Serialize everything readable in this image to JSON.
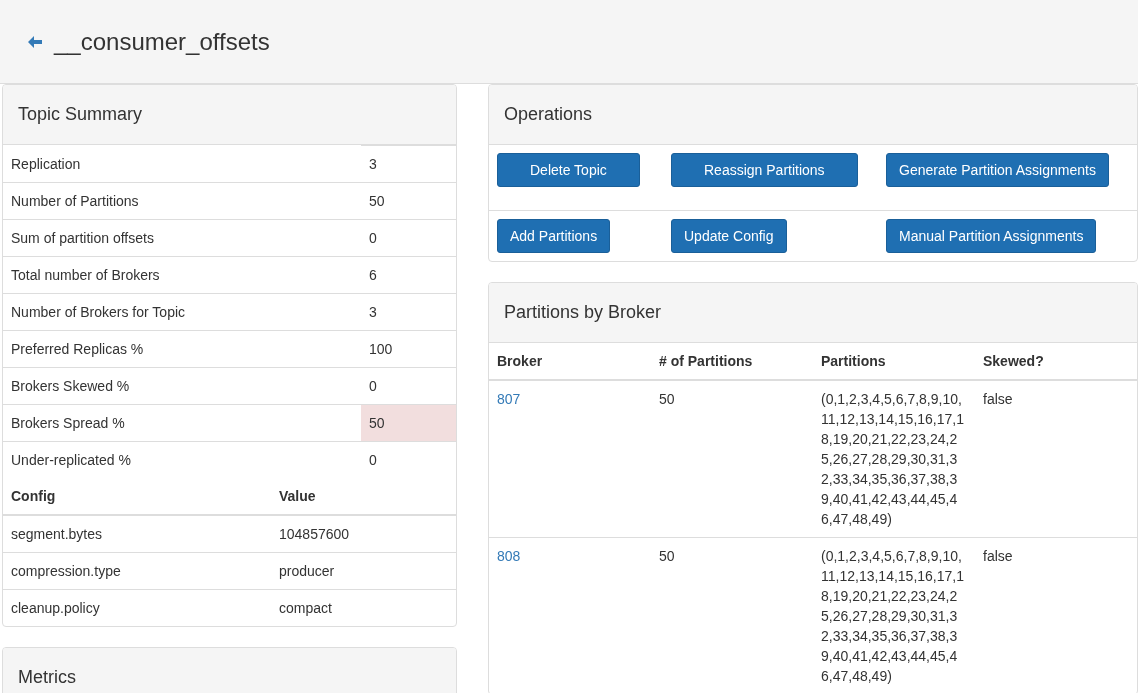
{
  "page": {
    "title": "__consumer_offsets"
  },
  "topic_summary": {
    "title": "Topic Summary",
    "rows": [
      {
        "label": "Replication",
        "value": "3",
        "warning": false
      },
      {
        "label": "Number of Partitions",
        "value": "50",
        "warning": false
      },
      {
        "label": "Sum of partition offsets",
        "value": "0",
        "warning": false
      },
      {
        "label": "Total number of Brokers",
        "value": "6",
        "warning": false
      },
      {
        "label": "Number of Brokers for Topic",
        "value": "3",
        "warning": false
      },
      {
        "label": "Preferred Replicas %",
        "value": "100",
        "warning": false
      },
      {
        "label": "Brokers Skewed %",
        "value": "0",
        "warning": false
      },
      {
        "label": "Brokers Spread %",
        "value": "50",
        "warning": true
      },
      {
        "label": "Under-replicated %",
        "value": "0",
        "warning": false
      }
    ],
    "config_columns": [
      "Config",
      "Value"
    ],
    "config_rows": [
      [
        "segment.bytes",
        "104857600"
      ],
      [
        "compression.type",
        "producer"
      ],
      [
        "cleanup.policy",
        "compact"
      ]
    ]
  },
  "metrics": {
    "title": "Metrics"
  },
  "operations": {
    "title": "Operations",
    "rows": [
      [
        "Delete Topic",
        "Reassign Partitions",
        "Generate Partition Assignments"
      ],
      [
        "Add Partitions",
        "Update Config",
        "Manual Partition Assignments"
      ]
    ]
  },
  "partitions_by_broker": {
    "title": "Partitions by Broker",
    "columns": [
      "Broker",
      "# of Partitions",
      "Partitions",
      "Skewed?"
    ],
    "rows": [
      {
        "broker": "807",
        "count": "50",
        "partitions": "(0,1,2,3,4,5,6,7,8,9,10,11,12,13,14,15,16,17,18,19,20,21,22,23,24,25,26,27,28,29,30,31,32,33,34,35,36,37,38,39,40,41,42,43,44,45,46,47,48,49)",
        "skewed": "false"
      },
      {
        "broker": "808",
        "count": "50",
        "partitions": "(0,1,2,3,4,5,6,7,8,9,10,11,12,13,14,15,16,17,18,19,20,21,22,23,24,25,26,27,28,29,30,31,32,33,34,35,36,37,38,39,40,41,42,43,44,45,46,47,48,49)",
        "skewed": "false"
      }
    ]
  }
}
